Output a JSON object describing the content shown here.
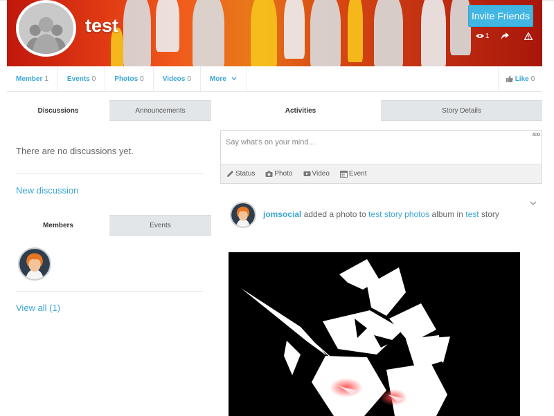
{
  "group": {
    "title": "test",
    "invite_label": "Invite Friends",
    "view_count": "1"
  },
  "nav": {
    "items": [
      {
        "label": "Member",
        "count": "1"
      },
      {
        "label": "Events",
        "count": "0"
      },
      {
        "label": "Photos",
        "count": "0"
      },
      {
        "label": "Videos",
        "count": "0"
      }
    ],
    "more_label": "More",
    "like_label": "Like",
    "like_count": "0"
  },
  "left": {
    "tabs": [
      "Discussions",
      "Announcements"
    ],
    "empty_text": "There are no discussions yet.",
    "new_discussion": "New discussion",
    "member_tabs": [
      "Members",
      "Events"
    ],
    "view_all": "View all (1)"
  },
  "right": {
    "tabs": [
      "Activities",
      "Story Details"
    ],
    "composer": {
      "placeholder": "Say what's on your mind...",
      "counter": "400",
      "actions": [
        "Status",
        "Photo",
        "Video",
        "Event"
      ]
    },
    "activity": {
      "actor": "jomsocial",
      "verb": "added a photo to",
      "album": "test story photos",
      "middle": "album in",
      "target": "test",
      "suffix": "story"
    }
  },
  "icons": {
    "cover_views": "eye-icon",
    "cover_share": "share-icon",
    "cover_report": "warning-icon",
    "like": "thumbs-up-icon",
    "more": "chevron-down-icon",
    "status": "pencil-icon",
    "photo": "camera-icon",
    "video": "video-icon",
    "event": "calendar-icon"
  },
  "colors": {
    "accent": "#3aa6d6",
    "invite_button": "#42b6e3",
    "tab_inactive": "#e3e6e8"
  }
}
